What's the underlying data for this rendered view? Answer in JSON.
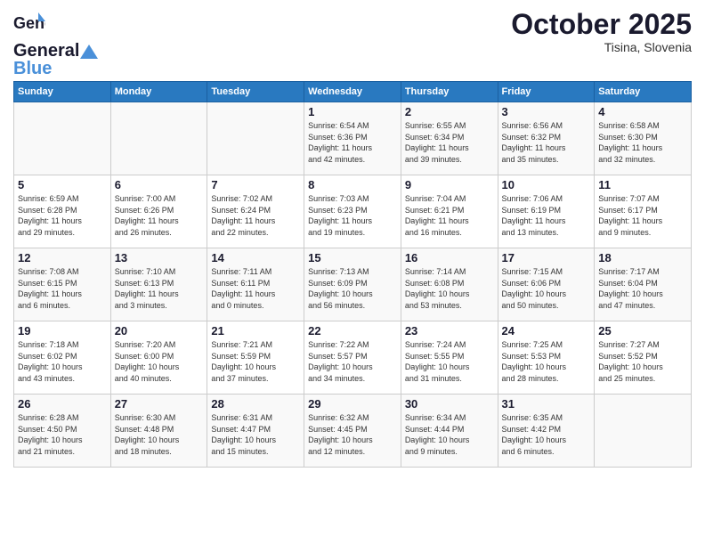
{
  "header": {
    "logo_general": "General",
    "logo_blue": "Blue",
    "month_title": "October 2025",
    "subtitle": "Tisina, Slovenia"
  },
  "days_of_week": [
    "Sunday",
    "Monday",
    "Tuesday",
    "Wednesday",
    "Thursday",
    "Friday",
    "Saturday"
  ],
  "weeks": [
    [
      {
        "day": "",
        "detail": ""
      },
      {
        "day": "",
        "detail": ""
      },
      {
        "day": "",
        "detail": ""
      },
      {
        "day": "1",
        "detail": "Sunrise: 6:54 AM\nSunset: 6:36 PM\nDaylight: 11 hours\nand 42 minutes."
      },
      {
        "day": "2",
        "detail": "Sunrise: 6:55 AM\nSunset: 6:34 PM\nDaylight: 11 hours\nand 39 minutes."
      },
      {
        "day": "3",
        "detail": "Sunrise: 6:56 AM\nSunset: 6:32 PM\nDaylight: 11 hours\nand 35 minutes."
      },
      {
        "day": "4",
        "detail": "Sunrise: 6:58 AM\nSunset: 6:30 PM\nDaylight: 11 hours\nand 32 minutes."
      }
    ],
    [
      {
        "day": "5",
        "detail": "Sunrise: 6:59 AM\nSunset: 6:28 PM\nDaylight: 11 hours\nand 29 minutes."
      },
      {
        "day": "6",
        "detail": "Sunrise: 7:00 AM\nSunset: 6:26 PM\nDaylight: 11 hours\nand 26 minutes."
      },
      {
        "day": "7",
        "detail": "Sunrise: 7:02 AM\nSunset: 6:24 PM\nDaylight: 11 hours\nand 22 minutes."
      },
      {
        "day": "8",
        "detail": "Sunrise: 7:03 AM\nSunset: 6:23 PM\nDaylight: 11 hours\nand 19 minutes."
      },
      {
        "day": "9",
        "detail": "Sunrise: 7:04 AM\nSunset: 6:21 PM\nDaylight: 11 hours\nand 16 minutes."
      },
      {
        "day": "10",
        "detail": "Sunrise: 7:06 AM\nSunset: 6:19 PM\nDaylight: 11 hours\nand 13 minutes."
      },
      {
        "day": "11",
        "detail": "Sunrise: 7:07 AM\nSunset: 6:17 PM\nDaylight: 11 hours\nand 9 minutes."
      }
    ],
    [
      {
        "day": "12",
        "detail": "Sunrise: 7:08 AM\nSunset: 6:15 PM\nDaylight: 11 hours\nand 6 minutes."
      },
      {
        "day": "13",
        "detail": "Sunrise: 7:10 AM\nSunset: 6:13 PM\nDaylight: 11 hours\nand 3 minutes."
      },
      {
        "day": "14",
        "detail": "Sunrise: 7:11 AM\nSunset: 6:11 PM\nDaylight: 11 hours\nand 0 minutes."
      },
      {
        "day": "15",
        "detail": "Sunrise: 7:13 AM\nSunset: 6:09 PM\nDaylight: 10 hours\nand 56 minutes."
      },
      {
        "day": "16",
        "detail": "Sunrise: 7:14 AM\nSunset: 6:08 PM\nDaylight: 10 hours\nand 53 minutes."
      },
      {
        "day": "17",
        "detail": "Sunrise: 7:15 AM\nSunset: 6:06 PM\nDaylight: 10 hours\nand 50 minutes."
      },
      {
        "day": "18",
        "detail": "Sunrise: 7:17 AM\nSunset: 6:04 PM\nDaylight: 10 hours\nand 47 minutes."
      }
    ],
    [
      {
        "day": "19",
        "detail": "Sunrise: 7:18 AM\nSunset: 6:02 PM\nDaylight: 10 hours\nand 43 minutes."
      },
      {
        "day": "20",
        "detail": "Sunrise: 7:20 AM\nSunset: 6:00 PM\nDaylight: 10 hours\nand 40 minutes."
      },
      {
        "day": "21",
        "detail": "Sunrise: 7:21 AM\nSunset: 5:59 PM\nDaylight: 10 hours\nand 37 minutes."
      },
      {
        "day": "22",
        "detail": "Sunrise: 7:22 AM\nSunset: 5:57 PM\nDaylight: 10 hours\nand 34 minutes."
      },
      {
        "day": "23",
        "detail": "Sunrise: 7:24 AM\nSunset: 5:55 PM\nDaylight: 10 hours\nand 31 minutes."
      },
      {
        "day": "24",
        "detail": "Sunrise: 7:25 AM\nSunset: 5:53 PM\nDaylight: 10 hours\nand 28 minutes."
      },
      {
        "day": "25",
        "detail": "Sunrise: 7:27 AM\nSunset: 5:52 PM\nDaylight: 10 hours\nand 25 minutes."
      }
    ],
    [
      {
        "day": "26",
        "detail": "Sunrise: 6:28 AM\nSunset: 4:50 PM\nDaylight: 10 hours\nand 21 minutes."
      },
      {
        "day": "27",
        "detail": "Sunrise: 6:30 AM\nSunset: 4:48 PM\nDaylight: 10 hours\nand 18 minutes."
      },
      {
        "day": "28",
        "detail": "Sunrise: 6:31 AM\nSunset: 4:47 PM\nDaylight: 10 hours\nand 15 minutes."
      },
      {
        "day": "29",
        "detail": "Sunrise: 6:32 AM\nSunset: 4:45 PM\nDaylight: 10 hours\nand 12 minutes."
      },
      {
        "day": "30",
        "detail": "Sunrise: 6:34 AM\nSunset: 4:44 PM\nDaylight: 10 hours\nand 9 minutes."
      },
      {
        "day": "31",
        "detail": "Sunrise: 6:35 AM\nSunset: 4:42 PM\nDaylight: 10 hours\nand 6 minutes."
      },
      {
        "day": "",
        "detail": ""
      }
    ]
  ]
}
